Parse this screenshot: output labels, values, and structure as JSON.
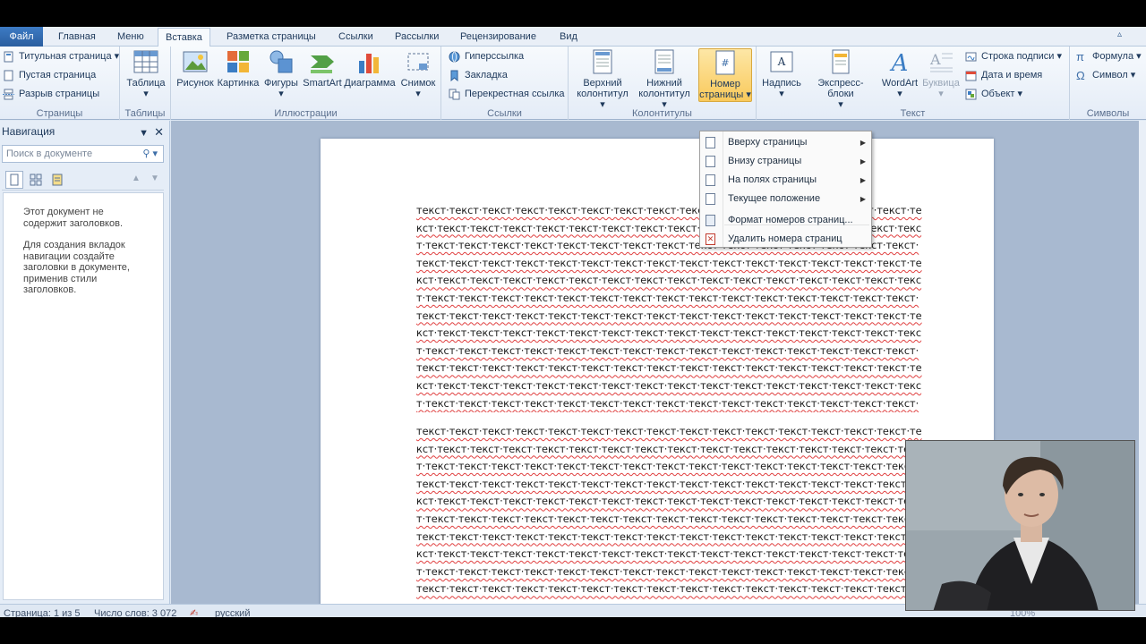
{
  "file_tab": "Файл",
  "tabs": [
    "Главная",
    "Меню",
    "Вставка",
    "Разметка страницы",
    "Ссылки",
    "Рассылки",
    "Рецензирование",
    "Вид"
  ],
  "ribbon": {
    "pages": {
      "title_page": "Титульная страница",
      "blank_page": "Пустая страница",
      "page_break": "Разрыв страницы",
      "label": "Страницы"
    },
    "tables": {
      "table": "Таблица",
      "label": "Таблицы"
    },
    "illustrations": {
      "picture": "Рисунок",
      "clipart": "Картинка",
      "shapes": "Фигуры",
      "smartart": "SmartArt",
      "chart": "Диаграмма",
      "screenshot": "Снимок",
      "label": "Иллюстрации"
    },
    "links": {
      "hyperlink": "Гиперссылка",
      "bookmark": "Закладка",
      "cross_ref": "Перекрестная ссылка",
      "label": "Ссылки"
    },
    "header_footer": {
      "header1": "Верхний",
      "header2": "колонтитул",
      "footer1": "Нижний",
      "footer2": "колонтитул",
      "page_num1": "Номер",
      "page_num2": "страницы",
      "label": "Колонтитулы"
    },
    "text": {
      "textbox": "Надпись",
      "quickparts": "Экспресс-блоки",
      "wordart": "WordArt",
      "dropcap": "Буквица",
      "sigline": "Строка подписи",
      "datetime": "Дата и время",
      "object": "Объект",
      "label": "Текст"
    },
    "symbols": {
      "equation": "Формула",
      "symbol": "Символ",
      "label": "Символы"
    }
  },
  "nav": {
    "title": "Навигация",
    "search_placeholder": "Поиск в документе",
    "msg1": "Этот документ не содержит заголовков.",
    "msg2": "Для создания вкладок навигации создайте заголовки в документе, применив стили заголовков."
  },
  "page_number_menu": [
    {
      "label": "Вверху страницы",
      "sub": true
    },
    {
      "label": "Внизу страницы",
      "sub": true
    },
    {
      "label": "На полях страницы",
      "sub": true
    },
    {
      "label": "Текущее положение",
      "sub": true
    },
    {
      "label": "Формат номеров страниц...",
      "sub": false
    },
    {
      "label": "Удалить номера страниц",
      "sub": false
    }
  ],
  "document": {
    "para1": "текст·текст·текст·текст·текст·текст·текст·текст·текст·текст·текст·текст·текст·текст·текст·текст·текст·текст·текст·текст·текст·текст·текст·текст·текст·текст·текст·текст·текст·текст·текст·текст·текст·текст·текст·текст·текст·текст·текст·текст·текст·текст·текст·текст·текст·текст·текст·текст·текст·текст·текст·текст·текст·текст·текст·текст·текст·текст·текст·текст·текст·текст·текст·текст·текст·текст·текст·текст·текст·текст·текст·текст·текст·текст·текст·текст·текст·текст·текст·текст·текст·текст·текст·текст·текст·текст·текст·текст·текст·текст·текст·текст·текст·текст·текст·текст·текст·текст·текст·текст·текст·текст·текст·текст·текст·текст·текст·текст·текст·текст·текст·текст·текст·текст·текст·текст·текст·текст·текст·текст·текст·текст·текст·текст·текст·текст·текст·текст·текст·текст·текст·текст·текст·текст·текст·текст·текст·текст·текст·текст·текст·текст·текст·текст·текст·текст·текст·текст·текст·текст·текст·текст·текст·текст·текст·текст·текст·текст·текст·текст·текст·текст·текст·текст·текст·текст·текст·текст·текст·текст·текст·текст·текст·текст·текст·текст·текст·текст·текст·текст·текст·текст·текст·текст·текст·текст·текст·текст·текст·текст·текст·текст¶",
    "para2": "текст·текст·текст·текст·текст·текст·текст·текст·текст·текст·текст·текст·текст·текст·текст·текст·текст·текст·текст·текст·текст·текст·текст·текст·текст·текст·текст·текст·текст·текст·текст·текст·текст·текст·текст·текст·текст·текст·текст·текст·текст·текст·текст·текст·текст·текст·текст·текст·текст·текст·текст·текст·текст·текст·текст·текст·текст·текст·текст·текст·текст·текст·текст·текст·текст·текст·текст·текст·текст·текст·текст·текст·текст·текст·текст·текст·текст·текст·текст·текст·текст·текст·текст·текст·текст·текст·текст·текст·текст·текст·текст·текст·текст·текст·текст·текст·текст·текст·текст·текст·текст·текст·текст·текст·текст·текст·текст·текст·текст·текст·текст·текст·текст·текст·текст·текст·текст·текст·текст·текст·текст·текст·текст·текст·текст·текст·текст·текст·текст·текст·текст·текст·текст·текст·текст·текст·текст·текст·текст·текст·текст·текст·текст·текст·текст·текст·текст·текст·текст·текст·текст·текст·текст·текст·текст·текст·текст·текст·текст"
  },
  "status": {
    "page": "Страница: 1 из 5",
    "words": "Число слов: 3 072",
    "lang": "русский",
    "zoom": "100%"
  }
}
